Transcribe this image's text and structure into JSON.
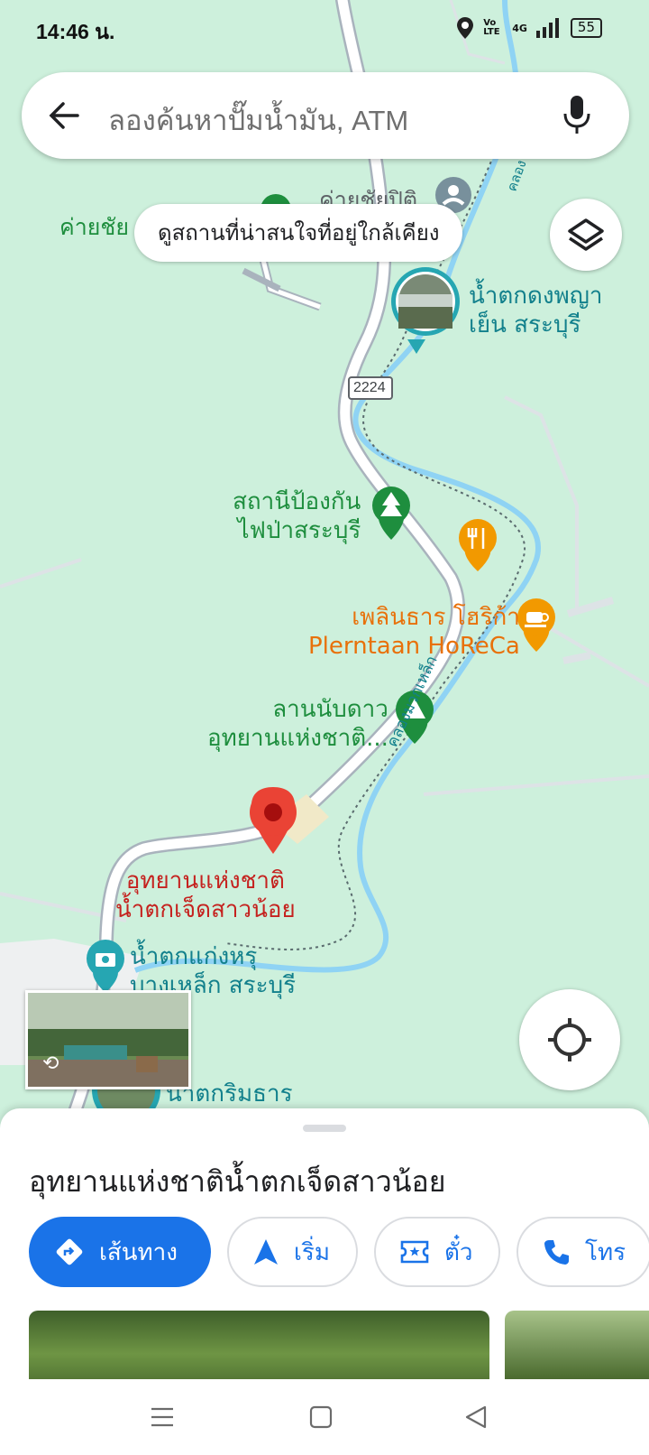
{
  "status": {
    "time": "14:46 น.",
    "volte": "Vo LTE",
    "network": "4G",
    "battery": "55"
  },
  "search": {
    "placeholder": "ลองค้นหาปั๊มน้ำมัน, ATM"
  },
  "chip": {
    "label": "ดูสถานที่น่าสนใจที่อยู่ใกล้เคียง"
  },
  "map": {
    "road_number": "2224",
    "labels": {
      "camp_left": "ค่ายชัย",
      "camp_top": "ค่ายชัยปิติ",
      "waterfall_dong_1": "น้ำตกดงพญา",
      "waterfall_dong_2": "เย็น สระบุรี",
      "fire_station_1": "สถานีป้องกัน",
      "fire_station_2": "ไฟป่าสระบุรี",
      "cafe_1": "เพลินธาร โฮริก้า",
      "cafe_2": "Plerntaan HoReCa",
      "camp_site_1": "ลานนับดาว",
      "camp_site_2": "อุทยานแห่งชาติ...",
      "selected_1": "อุทยานแห่งชาติ",
      "selected_2": "น้ำตกเจ็ดสาวน้อย",
      "kaeng_1": "น้ำตกแก่งหรุ",
      "kaeng_2": "บางเหล็ก สระบุรี",
      "rimthan": "น้ำตกริมธาร",
      "canal": "คลองมวกเหล็ก",
      "canal_top": "คลอง"
    }
  },
  "sheet": {
    "title": "อุทยานแห่งชาติน้ำตกเจ็ดสาวน้อย",
    "actions": {
      "directions": "เส้นทาง",
      "start": "เริ่ม",
      "tickets": "ตั๋ว",
      "call": "โทร"
    }
  },
  "colors": {
    "map_bg": "#cdf0dc",
    "water": "#8fd3f4",
    "road": "#ffffff",
    "accent_blue": "#1a73e8",
    "pin_red": "#ea4335",
    "teal_text": "#12808c",
    "green_text": "#1e8e3e",
    "orange_text": "#e8710a"
  }
}
